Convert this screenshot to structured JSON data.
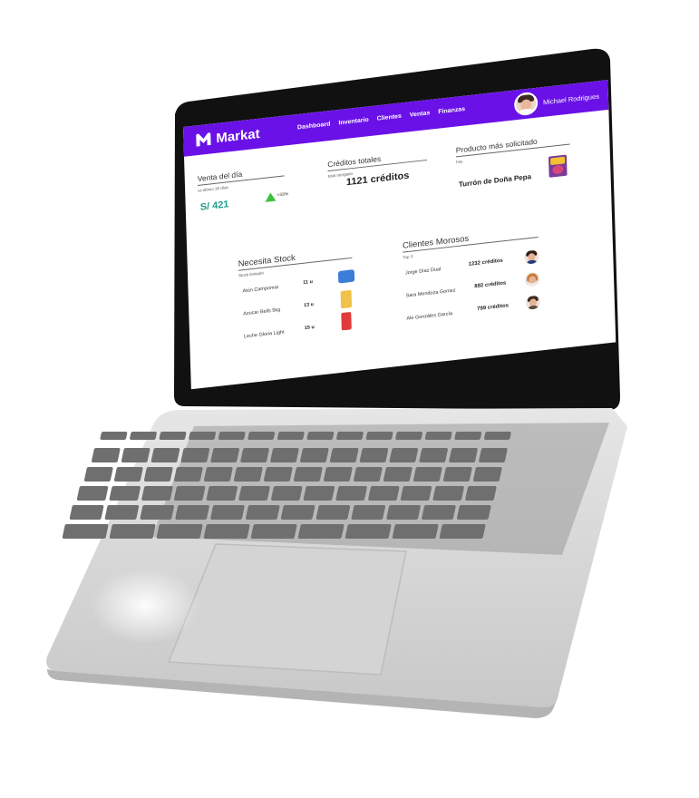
{
  "app": {
    "name": "Markat",
    "brand_color": "#6a11e8"
  },
  "nav": {
    "items": [
      "Dashboard",
      "Inventario",
      "Clientes",
      "Ventas",
      "Finanzas"
    ],
    "active": "Dashboard"
  },
  "user": {
    "name": "Michael Rodrigues"
  },
  "venta_dia": {
    "title": "Venta del día",
    "subtitle": "vs último 30 días",
    "value": "S/ 421",
    "change": "+33%",
    "trend": "up",
    "trend_color": "#3cc23c",
    "value_color": "#1b9e8a"
  },
  "creditos_totales": {
    "title": "Créditos totales",
    "subtitle": "total otorgado",
    "value": "1121 créditos"
  },
  "producto": {
    "title": "Producto más solicitado",
    "subtitle": "hoy",
    "name": "Turrón de Doña Pepa"
  },
  "stock": {
    "title": "Necesita Stock",
    "subtitle": "Stock limitado",
    "items": [
      {
        "name": "Atún Campomar",
        "qty": "11 u"
      },
      {
        "name": "Azucar Bells 5kg",
        "qty": "13 u"
      },
      {
        "name": "Leche Gloria Light",
        "qty": "15 u"
      }
    ]
  },
  "morosos": {
    "title": "Clientes Morosos",
    "subtitle": "Top 3",
    "items": [
      {
        "name": "Jorge Díaz Dual",
        "credits": "1232 créditos"
      },
      {
        "name": "Sara Mendoza Gomez",
        "credits": "892 créditos"
      },
      {
        "name": "Ale Gonzáles García",
        "credits": "799 créditos"
      }
    ]
  }
}
